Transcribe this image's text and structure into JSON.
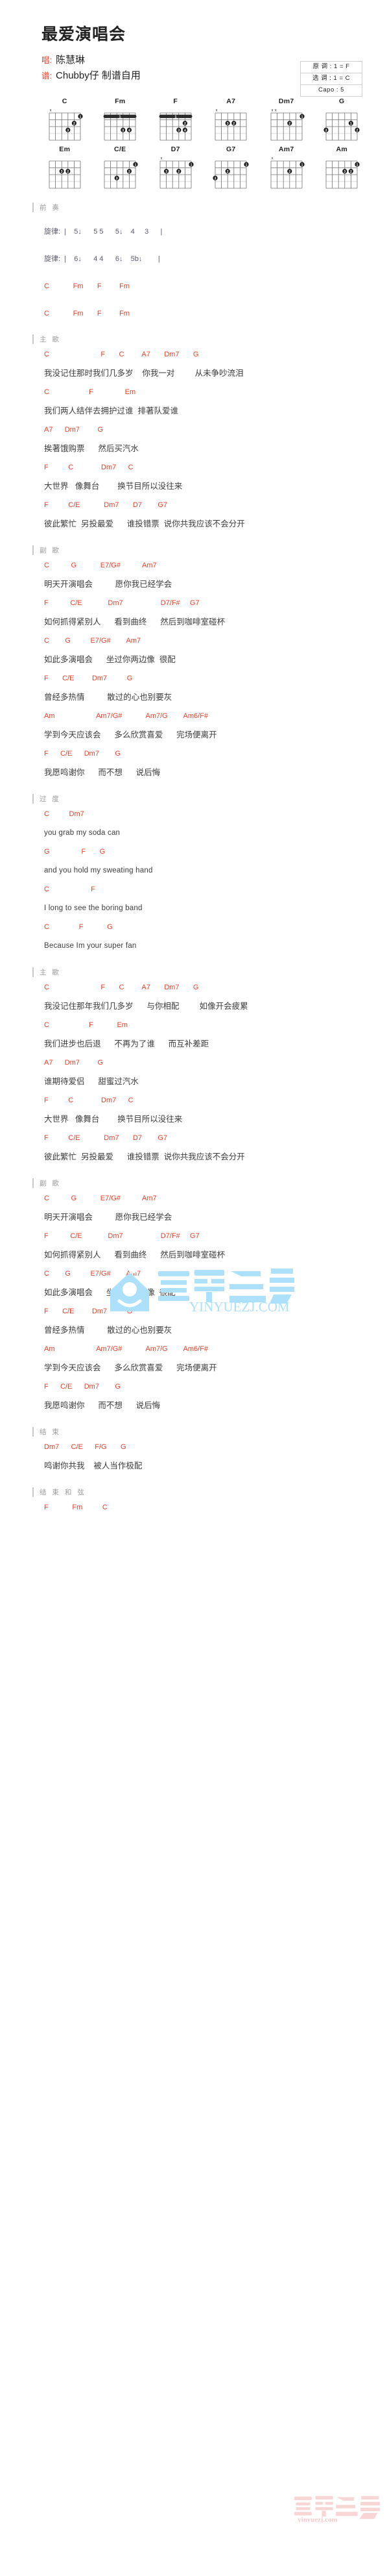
{
  "header": {
    "title": "最爱演唱会",
    "singer_key": "唱:",
    "singer": "陈慧琳",
    "arranger_key": "谱:",
    "arranger": "Chubby仔 制谱自用",
    "key_box": {
      "original": "原 调 : 1 = F",
      "selected": "选 调 : 1 = C",
      "capo": "Capo : 5"
    }
  },
  "chord_diagrams": [
    {
      "name": "C",
      "muted": "x....."
    },
    {
      "name": "Fm",
      "muted": "......"
    },
    {
      "name": "F",
      "muted": "......"
    },
    {
      "name": "A7",
      "muted": "x....."
    },
    {
      "name": "Dm7",
      "muted": "xx...."
    },
    {
      "name": "G",
      "muted": "......"
    },
    {
      "name": "Em",
      "muted": "......"
    },
    {
      "name": "C/E",
      "muted": "......"
    },
    {
      "name": "D7",
      "muted": "x....."
    },
    {
      "name": "G7",
      "muted": "......"
    },
    {
      "name": "Am7",
      "muted": "x....."
    },
    {
      "name": "Am",
      "muted": "......"
    }
  ],
  "watermark": {
    "brand_cn": "音樂之家",
    "brand_url": "YINYUEZJ.COM",
    "brand_url_bottom": "yinyuezj.com"
  },
  "sections": [
    {
      "label": "前 奏",
      "lines": [
        {
          "type": "spacer"
        },
        {
          "type": "melody",
          "text": "旋律:  |    5↓      5 5      5↓    4     3      |"
        },
        {
          "type": "spacer"
        },
        {
          "type": "melody",
          "text": "旋律:  |    6↓      4 4      6↓    5b↓        |"
        },
        {
          "type": "spacer"
        },
        {
          "type": "chord",
          "text": "C            Fm       F         Fm"
        },
        {
          "type": "spacer"
        },
        {
          "type": "chord",
          "text": "C            Fm       F         Fm"
        }
      ]
    },
    {
      "label": "主 歌",
      "lines": [
        {
          "type": "chord",
          "text": "C                          F       C         A7       Dm7       G"
        },
        {
          "type": "lyric",
          "text": "我没记住那时我们几多岁    你我一对         从未争吵流泪"
        },
        {
          "type": "chord",
          "text": "C                    F                Em"
        },
        {
          "type": "lyric",
          "text": "我们两人结伴去拥护过谁  排著队爱谁"
        },
        {
          "type": "chord",
          "text": "A7      Dm7         G"
        },
        {
          "type": "lyric",
          "text": "挨著饿购票      然后买汽水"
        },
        {
          "type": "chord",
          "text": "F          C              Dm7      C"
        },
        {
          "type": "lyric",
          "text": "大世界   像舞台        换节目所以没往来"
        },
        {
          "type": "chord",
          "text": "F          C/E            Dm7       D7        G7"
        },
        {
          "type": "lyric",
          "text": "彼此繁忙  另投最爱      谁投错票  说你共我应该不会分开"
        }
      ]
    },
    {
      "label": "副 歌",
      "lines": [
        {
          "type": "chord",
          "text": "C           G            E7/G#           Am7"
        },
        {
          "type": "lyric",
          "text": "明天开演唱会          愿你我已经学会"
        },
        {
          "type": "chord",
          "text": "F           C/E             Dm7                   D7/F#     G7"
        },
        {
          "type": "lyric",
          "text": "如何抓得紧别人      看到曲终      然后到咖啡室碰杯"
        },
        {
          "type": "chord",
          "text": "C        G          E7/G#        Am7"
        },
        {
          "type": "lyric",
          "text": "如此多演唱会      坐过你两边像  很配"
        },
        {
          "type": "chord",
          "text": "F       C/E         Dm7          G"
        },
        {
          "type": "lyric",
          "text": "曾经多热情          散过的心也别要灰"
        },
        {
          "type": "chord",
          "text": "Am                     Am7/G#            Am7/G        Am6/F#"
        },
        {
          "type": "lyric",
          "text": "学到今天应该会      多么欣赏喜爱      完场便离开"
        },
        {
          "type": "chord",
          "text": "F      C/E      Dm7        G"
        },
        {
          "type": "lyric",
          "text": "我愿鸣谢你      而不想      说后悔"
        }
      ]
    },
    {
      "label": "过 度",
      "lines": [
        {
          "type": "chord",
          "text": "C          Dm7"
        },
        {
          "type": "lyric_en",
          "text": "you grab my soda can"
        },
        {
          "type": "chord",
          "text": "G                F       G"
        },
        {
          "type": "lyric_en",
          "text": "and you hold my sweating hand"
        },
        {
          "type": "chord",
          "text": "C                     F"
        },
        {
          "type": "lyric_en",
          "text": "I long to see the boring band"
        },
        {
          "type": "chord",
          "text": "C               F            G"
        },
        {
          "type": "lyric_en",
          "text": "Because Im your super fan"
        }
      ]
    },
    {
      "label": "主 歌",
      "lines": [
        {
          "type": "chord",
          "text": "C                          F       C         A7       Dm7       G"
        },
        {
          "type": "lyric",
          "text": "我没记住那年我们几多岁      与你相配         如像开会疲累"
        },
        {
          "type": "chord",
          "text": "C                    F            Em"
        },
        {
          "type": "lyric",
          "text": "我们进步也后退      不再为了谁      而互补差距"
        },
        {
          "type": "chord",
          "text": "A7      Dm7         G"
        },
        {
          "type": "lyric",
          "text": "谁期待爱侣      甜蜜过汽水"
        },
        {
          "type": "chord",
          "text": "F          C              Dm7      C"
        },
        {
          "type": "lyric",
          "text": "大世界   像舞台        换节目所以没往来"
        },
        {
          "type": "chord",
          "text": "F          C/E            Dm7       D7        G7"
        },
        {
          "type": "lyric",
          "text": "彼此繁忙  另投最爱      谁投错票  说你共我应该不会分开"
        }
      ]
    },
    {
      "label": "副 歌",
      "lines": [
        {
          "type": "chord",
          "text": "C           G            E7/G#           Am7"
        },
        {
          "type": "lyric",
          "text": "明天开演唱会          愿你我已经学会"
        },
        {
          "type": "chord",
          "text": "F           C/E             Dm7                   D7/F#     G7"
        },
        {
          "type": "lyric",
          "text": "如何抓得紧别人      看到曲终      然后到咖啡室碰杯"
        },
        {
          "type": "chord",
          "text": "C        G          E7/G#        Am7"
        },
        {
          "type": "lyric",
          "text": "如此多演唱会      坐过你两边像  很配"
        },
        {
          "type": "chord",
          "text": "F       C/E         Dm7          G"
        },
        {
          "type": "lyric",
          "text": "曾经多热情          散过的心也别要灰"
        },
        {
          "type": "chord",
          "text": "Am                     Am7/G#            Am7/G        Am6/F#"
        },
        {
          "type": "lyric",
          "text": "学到今天应该会      多么欣赏喜爱      完场便离开"
        },
        {
          "type": "chord",
          "text": "F      C/E      Dm7        G"
        },
        {
          "type": "lyric",
          "text": "我愿鸣谢你      而不想      说后悔"
        }
      ]
    },
    {
      "label": "结 束",
      "lines": [
        {
          "type": "chord",
          "text": "Dm7      C/E      F/G       G"
        },
        {
          "type": "lyric",
          "text": "鸣谢你共我    被人当作极配"
        }
      ]
    },
    {
      "label": "结 束 和 弦",
      "lines": [
        {
          "type": "chord",
          "text": "F            Fm          C"
        }
      ]
    }
  ]
}
